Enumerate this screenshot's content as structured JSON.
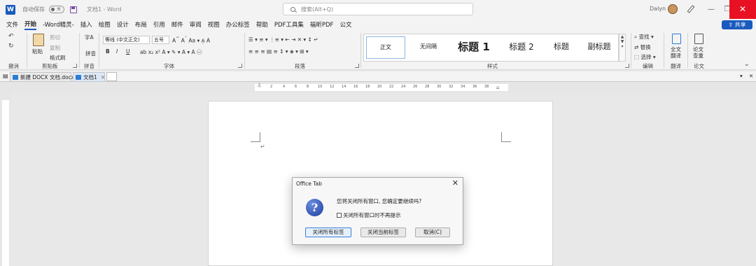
{
  "titlebar": {
    "autosave_label": "自动保存",
    "autosave_state": "关",
    "doc_title": "文档1  -  Word",
    "search_placeholder": "搜索(Alt+Q)",
    "user_name": "Dalyn",
    "minimize": "—",
    "restore": "❐",
    "close": "✕"
  },
  "menu": {
    "items": [
      "文件",
      "开始",
      "-Word精灵-",
      "插入",
      "绘图",
      "设计",
      "布局",
      "引用",
      "邮件",
      "审阅",
      "视图",
      "办公标签",
      "帮助",
      "PDF工具集",
      "福昕PDF",
      "公文"
    ],
    "active": "开始",
    "share": "共享"
  },
  "ribbon": {
    "undo_group": "撤消",
    "clipboard": {
      "paste": "粘贴",
      "cut": "剪切",
      "copy": "复制",
      "format_painter": "格式刷",
      "label": "剪贴板"
    },
    "pinyin": {
      "top": "字A",
      "text": "拼音",
      "label": "拼音"
    },
    "font": {
      "name": "等线 (中文正文)",
      "size": "五号",
      "label": "字体"
    },
    "paragraph": {
      "label": "段落"
    },
    "styles": {
      "items": [
        "正文",
        "无间隔",
        "标题 1",
        "标题 2",
        "标题",
        "副标题"
      ],
      "label": "样式"
    },
    "editing": {
      "find": "查找",
      "replace": "替换",
      "select": "选择",
      "label": "编辑"
    },
    "translate": {
      "text": "全文翻译",
      "label": "翻译"
    },
    "paper": {
      "text": "论文查重",
      "label": "论文"
    }
  },
  "tabs": [
    {
      "label": "新建 DOCX 文档.docx",
      "active": false
    },
    {
      "label": "文档1",
      "active": true
    }
  ],
  "ruler": {
    "numbers": [
      "2",
      "4",
      "6",
      "8",
      "10",
      "12",
      "14",
      "16",
      "18",
      "20",
      "22",
      "24",
      "26",
      "28",
      "30",
      "32",
      "34",
      "36",
      "38"
    ]
  },
  "document": {
    "paragraph_mark": "↵"
  },
  "dialog": {
    "title": "Office Tab",
    "icon": "?",
    "message": "您将关闭所有窗口, 您确定要继续吗?",
    "checkbox_label": "关闭所有窗口时不再提示",
    "buttons": {
      "close_all": "关闭所有标签",
      "close_current": "关闭当前标签",
      "cancel": "取消(C)"
    }
  },
  "colors": {
    "accent": "#185abd",
    "close_red": "#e81123"
  }
}
